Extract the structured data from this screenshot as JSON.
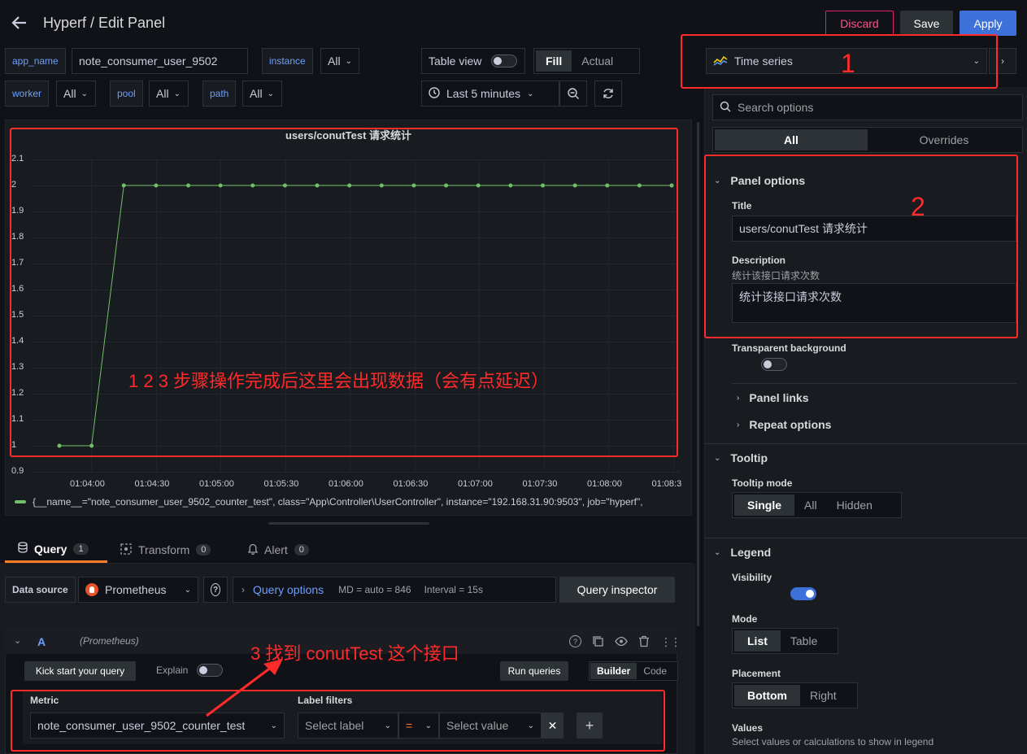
{
  "header": {
    "title": "Hyperf / Edit Panel",
    "discard": "Discard",
    "save": "Save",
    "apply": "Apply"
  },
  "variables": [
    {
      "name": "app_name",
      "value": "note_consumer_user_9502"
    },
    {
      "name": "instance",
      "value": "All"
    },
    {
      "name": "worker",
      "value": "All"
    },
    {
      "name": "pool",
      "value": "All"
    },
    {
      "name": "path",
      "value": "All"
    }
  ],
  "toolbar": {
    "table_view": "Table view",
    "fill": "Fill",
    "actual": "Actual",
    "time_range": "Last 5 minutes"
  },
  "viz": {
    "name": "Time series"
  },
  "options": {
    "search_placeholder": "Search options",
    "tabs": [
      "All",
      "Overrides"
    ],
    "panel_options": "Panel options",
    "title_label": "Title",
    "title_value": "users/conutTest 请求统计",
    "desc_label": "Description",
    "desc_hint": "统计该接口请求次数",
    "desc_value": "统计该接口请求次数",
    "transparent": "Transparent background",
    "panel_links": "Panel links",
    "repeat_options": "Repeat options",
    "tooltip": "Tooltip",
    "tooltip_mode": "Tooltip mode",
    "tooltip_modes": [
      "Single",
      "All",
      "Hidden"
    ],
    "legend": "Legend",
    "visibility": "Visibility",
    "mode": "Mode",
    "modes": [
      "List",
      "Table"
    ],
    "placement": "Placement",
    "placements": [
      "Bottom",
      "Right"
    ],
    "values": "Values",
    "values_hint": "Select values or calculations to show in legend"
  },
  "chart_data": {
    "type": "line",
    "title": "users/conutTest 请求统计",
    "yticks": [
      "2.1",
      "2",
      "1.9",
      "1.8",
      "1.7",
      "1.6",
      "1.5",
      "1.4",
      "1.3",
      "1.2",
      "1.1",
      "1",
      "0.9"
    ],
    "xticks": [
      "01:04:00",
      "01:04:30",
      "01:05:00",
      "01:05:30",
      "01:06:00",
      "01:06:30",
      "01:07:00",
      "01:07:30",
      "01:08:00",
      "01:08:3"
    ],
    "ylim": [
      0.9,
      2.1
    ],
    "series": [
      {
        "name": "{__name__=\"note_consumer_user_9502_counter_test\", class=\"App\\Controller\\UserController\", instance=\"192.168.31.90:9503\", job=\"hyperf\",",
        "color": "#73bf69",
        "values": [
          1,
          1,
          2,
          2,
          2,
          2,
          2,
          2,
          2,
          2,
          2,
          2,
          2,
          2,
          2,
          2,
          2,
          2,
          2,
          2
        ]
      }
    ]
  },
  "annotations": {
    "n1": "1",
    "n2": "2",
    "chart_note": "1 2 3 步骤操作完成后这里会出现数据（会有点延迟）",
    "n3": "3 找到 conutTest 这个接口"
  },
  "query_tabs": [
    {
      "label": "Query",
      "count": "1"
    },
    {
      "label": "Transform",
      "count": "0"
    },
    {
      "label": "Alert",
      "count": "0"
    }
  ],
  "query": {
    "data_source_label": "Data source",
    "data_source": "Prometheus",
    "query_options": "Query options",
    "md": "MD = auto = 846",
    "interval": "Interval = 15s",
    "inspector": "Query inspector",
    "ref": "A",
    "ref_ds": "(Prometheus)",
    "kick_start": "Kick start your query",
    "explain": "Explain",
    "run": "Run queries",
    "builder": "Builder",
    "code": "Code",
    "metric_label": "Metric",
    "metric_value": "note_consumer_user_9502_counter_test",
    "label_filters": "Label filters",
    "select_label": "Select label",
    "op": "=",
    "select_value": "Select value"
  }
}
